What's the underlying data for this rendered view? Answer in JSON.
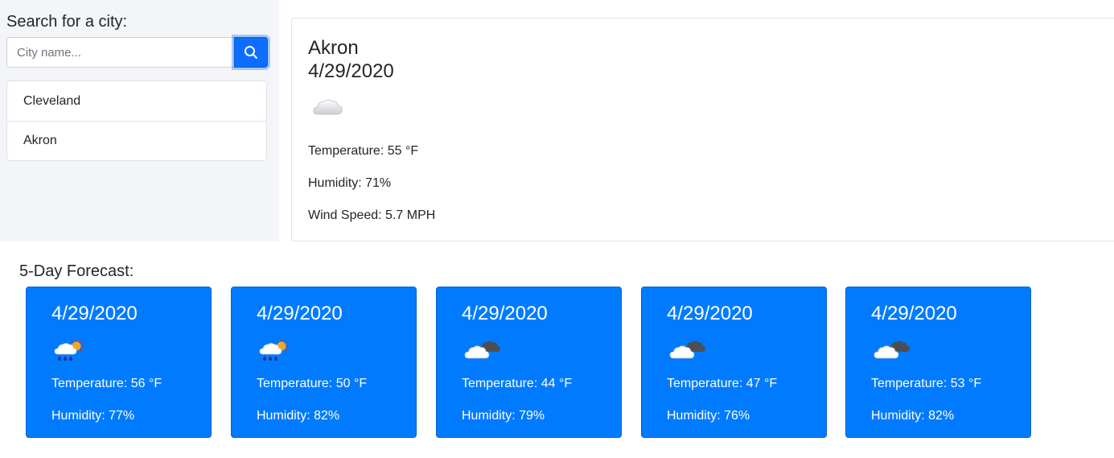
{
  "search": {
    "label": "Search for a city:",
    "placeholder": "City name...",
    "value": ""
  },
  "history": [
    "Cleveland",
    "Akron"
  ],
  "current": {
    "city": "Akron",
    "date": "4/29/2020",
    "icon": "cloud-icon",
    "temperature": "Temperature: 55 °F",
    "humidity": "Humidity: 71%",
    "wind": "Wind Speed: 5.7 MPH"
  },
  "forecast": {
    "title": "5-Day Forecast:",
    "days": [
      {
        "date": "4/29/2020",
        "icon": "rain-sun-cloud-icon",
        "temperature": "Temperature: 56 °F",
        "humidity": "Humidity: 77%"
      },
      {
        "date": "4/29/2020",
        "icon": "rain-sun-cloud-icon",
        "temperature": "Temperature: 50 °F",
        "humidity": "Humidity: 82%"
      },
      {
        "date": "4/29/2020",
        "icon": "dark-clouds-icon",
        "temperature": "Temperature: 44 °F",
        "humidity": "Humidity: 79%"
      },
      {
        "date": "4/29/2020",
        "icon": "dark-clouds-icon",
        "temperature": "Temperature: 47 °F",
        "humidity": "Humidity: 76%"
      },
      {
        "date": "4/29/2020",
        "icon": "dark-clouds-icon",
        "temperature": "Temperature: 53 °F",
        "humidity": "Humidity: 82%"
      }
    ]
  },
  "colors": {
    "accent": "#007bff",
    "search_button": "#0d6efd",
    "sidebar_bg": "#f4f5f8"
  }
}
